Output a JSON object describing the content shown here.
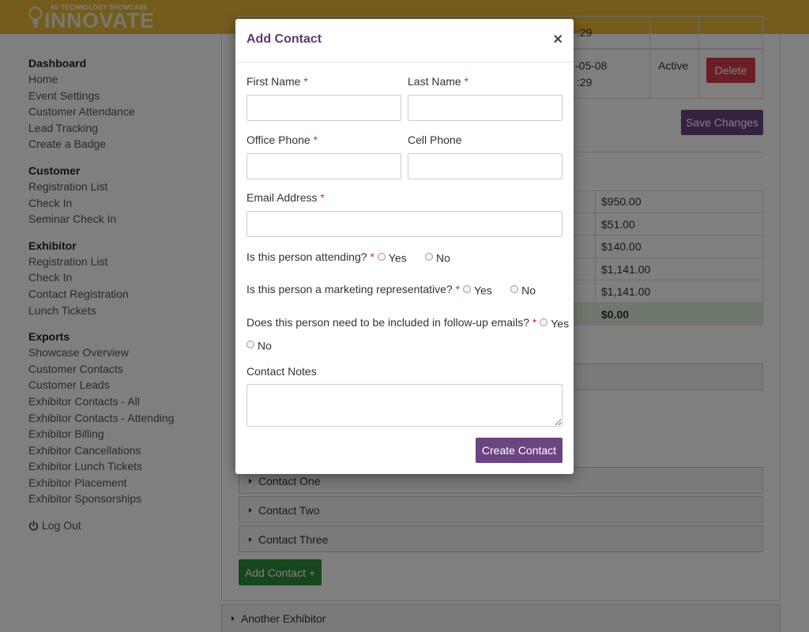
{
  "header": {
    "tagline": "AV TECHNOLOGY SHOWCASE",
    "brand": "INNOVATE",
    "bg_color": "#e9b93a"
  },
  "sidebar": {
    "groups": [
      {
        "heading": "Dashboard",
        "items": [
          "Home",
          "Event Settings",
          "Customer Attendance",
          "Lead Tracking",
          "Create a Badge"
        ]
      },
      {
        "heading": "Customer",
        "items": [
          "Registration List",
          "Check In",
          "Seminar Check In"
        ]
      },
      {
        "heading": "Exhibitor",
        "items": [
          "Registration List",
          "Check In",
          "Contact Registration",
          "Lunch Tickets"
        ]
      },
      {
        "heading": "Exports",
        "items": [
          "Showcase Overview",
          "Customer Contacts",
          "Customer Leads",
          "Exhibitor Contacts - All",
          "Exhibitor Contacts - Attending",
          "Exhibitor Billing",
          "Exhibitor Cancellations",
          "Exhibitor Lunch Tickets",
          "Exhibitor Placement",
          "Exhibitor Sponsorships"
        ]
      }
    ],
    "logout": "Log Out"
  },
  "main": {
    "row_date": "-05-08",
    "row_time_a": ":29",
    "row_time_b": ":29",
    "row_status": "Active",
    "delete_label": "Delete",
    "save_label": "Save Changes",
    "billing_amounts": [
      "$950.00",
      "$51.00",
      "$140.00",
      "$1,141.00",
      "$1,141.00"
    ],
    "billing_total": "$0.00",
    "contacts": [
      "Contact One",
      "Contact Two",
      "Contact Three"
    ],
    "add_contact_label": "Add Contact +",
    "another_exhibitor": "Another Exhibitor"
  },
  "modal": {
    "title": "Add Contact",
    "close": "×",
    "first_name_label": "First Name",
    "last_name_label": "Last Name",
    "office_phone_label": "Office Phone",
    "cell_phone_label": "Cell Phone",
    "email_label": "Email Address",
    "required_mark": "*",
    "q_attending": "Is this person attending?",
    "q_marketing": "Is this person a marketing representative?",
    "q_followup": "Does this person need to be included in follow-up emails?",
    "yes": "Yes",
    "no": "No",
    "notes_label": "Contact Notes",
    "submit_label": "Create Contact"
  }
}
